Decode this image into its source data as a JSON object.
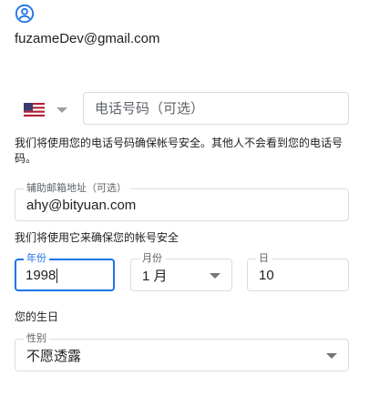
{
  "account": {
    "icon": "account-circle-icon",
    "email": "fuzameDev@gmail.com"
  },
  "phone": {
    "country_flag": "us-flag-icon",
    "placeholder": "电话号码（可选）",
    "value": "",
    "hint": "我们将使用您的电话号码确保帐号安全。其他人不会看到您的电话号码。"
  },
  "recovery_email": {
    "label": "辅助邮箱地址（可选）",
    "value": "ahy@bityuan.com",
    "hint": "我们将使用它来确保您的帐号安全"
  },
  "birthday": {
    "year_label": "年份",
    "year_value": "1998",
    "month_label": "月份",
    "month_value": "1 月",
    "day_label": "日",
    "day_value": "10",
    "hint": "您的生日"
  },
  "gender": {
    "label": "性别",
    "value": "不愿透露"
  },
  "colors": {
    "accent": "#1a73e8",
    "border": "#dadce0",
    "text": "#202124"
  }
}
